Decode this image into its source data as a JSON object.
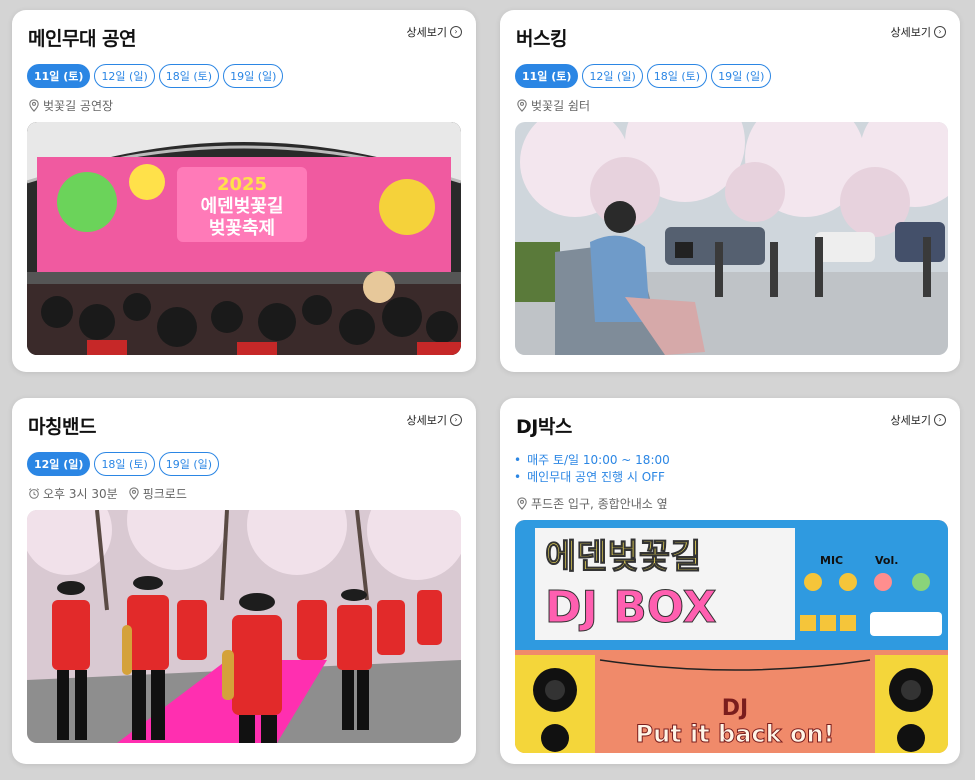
{
  "detail_label": "상세보기",
  "colors": {
    "accent": "#2b86e4",
    "text_muted": "#666666"
  },
  "cards": [
    {
      "title": "메인무대 공연",
      "dates": [
        "11일 (토)",
        "12일 (일)",
        "18일 (토)",
        "19일 (일)"
      ],
      "active_date": 0,
      "location": "벚꽃길 공연장",
      "photo": {
        "description_icon": "stage-concert-photo",
        "poster_year": "2025",
        "poster_title_1": "에덴벚꽃길",
        "poster_title_2": "벚꽃축제"
      }
    },
    {
      "title": "버스킹",
      "dates": [
        "11일 (토)",
        "12일 (일)",
        "18일 (토)",
        "19일 (일)"
      ],
      "active_date": 0,
      "location": "벚꽃길 쉼터",
      "photo": {
        "description_icon": "busking-photo"
      }
    },
    {
      "title": "마칭밴드",
      "dates": [
        "12일 (일)",
        "18일 (토)",
        "19일 (일)"
      ],
      "active_date": 0,
      "time": "오후 3시 30분",
      "location": "핑크로드",
      "photo": {
        "description_icon": "marching-band-photo"
      }
    },
    {
      "title": "DJ박스",
      "bullets": [
        "매주 토/일 10:00 ~ 18:00",
        "메인무대 공연 진행 시  OFF"
      ],
      "location": "푸드존 입구, 종합안내소 옆",
      "photo": {
        "description_icon": "dj-box-photo",
        "sign_line_1": "에덴벚꽃길",
        "sign_line_2": "DJ BOX",
        "mic_label": "MIC",
        "vol_label": "Vol.",
        "banner_line_1": "DJ",
        "banner_line_2": "Put it back on!"
      }
    }
  ]
}
